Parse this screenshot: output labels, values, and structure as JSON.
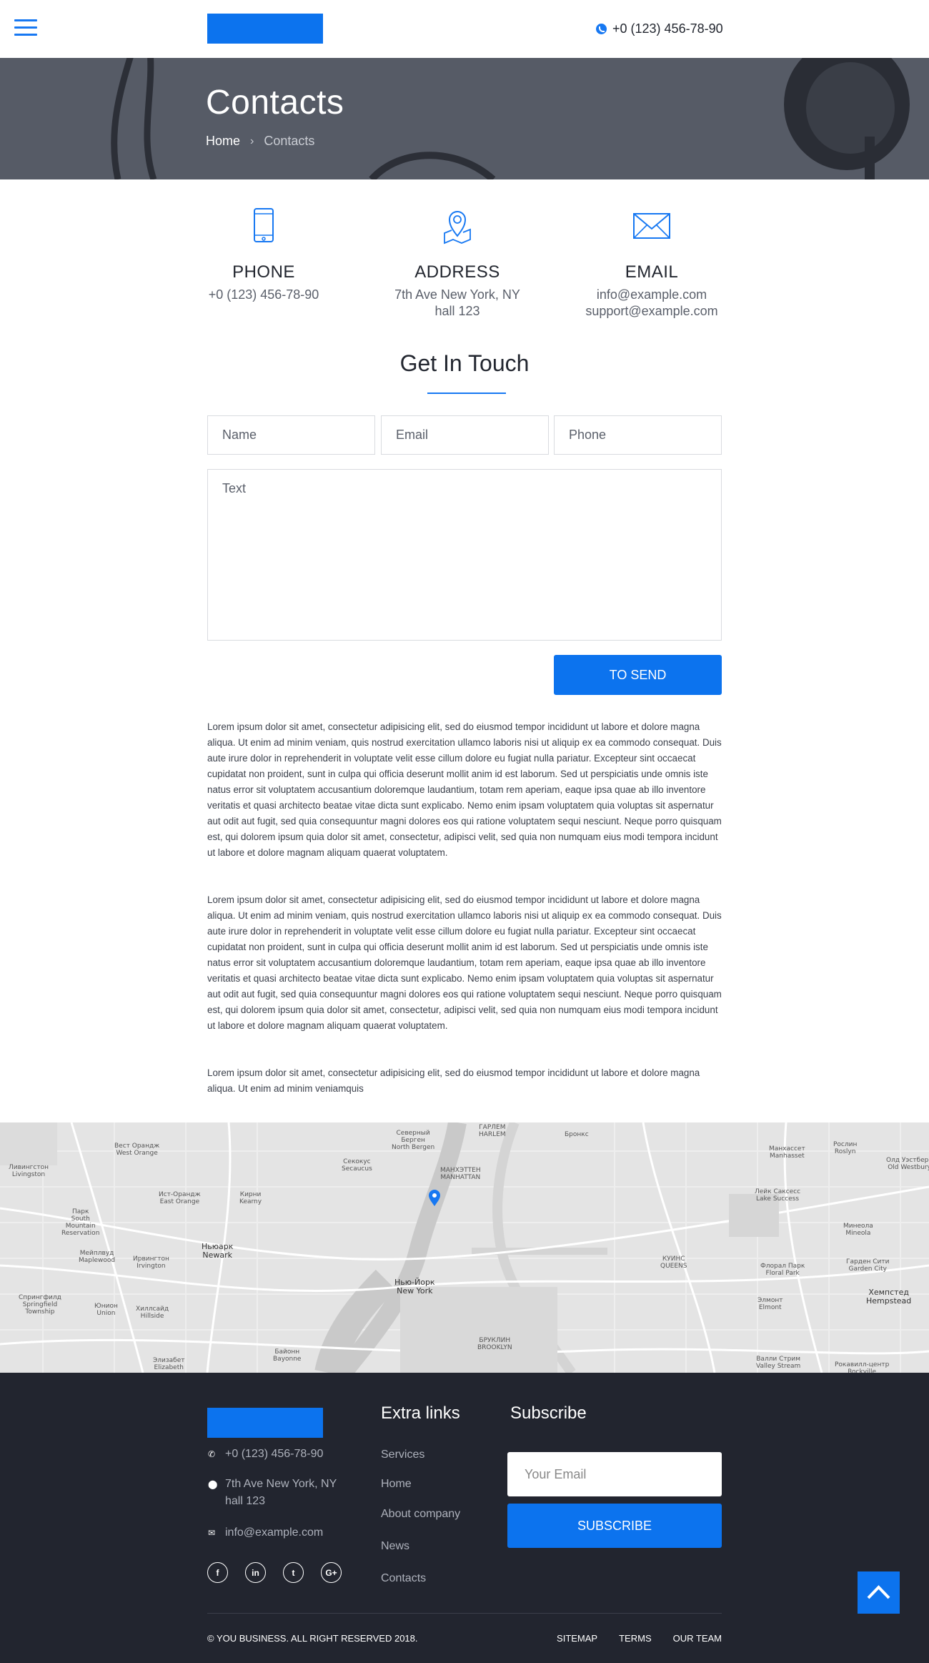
{
  "header": {
    "phone": "+0 (123) 456-78-90",
    "icons": [
      "menu-icon",
      "phone-icon"
    ]
  },
  "hero": {
    "title": "Contacts",
    "breadcrumb": {
      "home": "Home",
      "separator": "›",
      "current": "Contacts"
    }
  },
  "contact_info": [
    {
      "icon": "smartphone-icon",
      "title": "PHONE",
      "lines": [
        "+0 (123) 456-78-90"
      ]
    },
    {
      "icon": "map-pin-icon",
      "title": "ADDRESS",
      "lines": [
        "7th Ave New York, NY",
        "hall 123"
      ]
    },
    {
      "icon": "envelope-icon",
      "title": "EMAIL",
      "lines": [
        "info@example.com",
        "support@example.com"
      ]
    }
  ],
  "form": {
    "title": "Get In Touch",
    "name_placeholder": "Name",
    "email_placeholder": "Email",
    "phone_placeholder": "Phone",
    "text_placeholder": "Text",
    "submit_label": "TO SEND"
  },
  "paragraphs": [
    "Lorem ipsum dolor sit amet, consectetur adipisicing elit, sed do eiusmod tempor incididunt ut labore et dolore magna aliqua. Ut enim ad minim veniam, quis nostrud exercitation ullamco laboris nisi ut aliquip ex ea commodo consequat. Duis aute irure dolor in reprehenderit in voluptate velit esse cillum dolore eu fugiat nulla pariatur. Excepteur sint occaecat cupidatat non proident, sunt in culpa qui officia deserunt mollit anim id est laborum. Sed ut perspiciatis unde omnis iste natus error sit voluptatem accusantium doloremque laudantium, totam rem aperiam, eaque ipsa quae ab illo inventore veritatis et quasi architecto beatae vitae dicta sunt explicabo. Nemo enim ipsam voluptatem quia voluptas sit aspernatur aut odit aut fugit, sed quia consequuntur magni dolores eos qui ratione voluptatem sequi nesciunt. Neque porro quisquam est, qui dolorem ipsum quia dolor sit amet, consectetur, adipisci velit, sed quia non numquam eius modi tempora incidunt ut labore et dolore magnam aliquam quaerat voluptatem.",
    "Lorem ipsum dolor sit amet, consectetur adipisicing elit, sed do eiusmod tempor incididunt ut labore et dolore magna aliqua. Ut enim ad minim veniam, quis nostrud exercitation ullamco laboris nisi ut aliquip ex ea commodo consequat. Duis aute irure dolor in reprehenderit in voluptate velit esse cillum dolore eu fugiat nulla pariatur. Excepteur sint occaecat cupidatat non proident, sunt in culpa qui officia deserunt mollit anim id est laborum. Sed ut perspiciatis unde omnis iste natus error sit voluptatem accusantium doloremque laudantium, totam rem aperiam, eaque ipsa quae ab illo inventore veritatis et quasi architecto beatae vitae dicta sunt explicabo. Nemo enim ipsam voluptatem quia voluptas sit aspernatur aut odit aut fugit, sed quia consequuntur magni dolores eos qui ratione voluptatem sequi nesciunt. Neque porro quisquam est, qui dolorem ipsum quia dolor sit amet, consectetur, adipisci velit, sed quia non numquam eius modi tempora incidunt ut labore et dolore magnam aliquam quaerat voluptatem.",
    "Lorem ipsum dolor sit amet, consectetur adipisicing elit, sed do eiusmod tempor incididunt ut labore et dolore magna aliqua. Ut enim ad minim veniamquis"
  ],
  "map": {
    "marker_icon": "map-marker-icon",
    "labels": [
      "Вест Орандж\nWest Orange",
      "Ливингстон\nLivingston",
      "Ист-Орандж\nEast Orange",
      "Кирни\nKearny",
      "Секокус\nSecaucus",
      "Северный\nБерген\nNorth Bergen",
      "ГАРЛЕМ\nHARLEM",
      "МАНХЭТТЕН\nMANHATTAN",
      "Ньюарк\nNewark",
      "Нью-Йорк\nNew York",
      "КУИНС\nQUEENS",
      "Бронкс",
      "Манхассет\nManhasset",
      "Рослин\nRoslyn",
      "Олд Уэстбери\nOld Westbury",
      "Лейк Саксесс\nLake Success",
      "Минеола\nMineola",
      "Гарден Сити\nGarden City",
      "Хемпстед\nHempstead",
      "Флорал Парк\nFloral Park",
      "Элмонт\nElmont",
      "Валли Стрим\nValley Stream",
      "Байонн\nBayonne",
      "Элизабет\nElizabeth",
      "Юнион\nUnion",
      "Хиллсайд\nHillside",
      "Ирвингтон\nIrvington",
      "Мейплвуд\nMaplewood",
      "Спрингфилд\nSpringfield\nTownship",
      "Парк\nSouth\nMountain\nReservation",
      "БРУКЛИН\nBROOKLYN",
      "Рокавилл-центр\nRockville"
    ]
  },
  "footer": {
    "phone": "+0 (123) 456-78-90",
    "address_line1": "7th Ave New York, NY",
    "address_line2": "hall 123",
    "email": "info@example.com",
    "socials": [
      "f",
      "in",
      "t",
      "G+"
    ],
    "extra_links_title": "Extra links",
    "extra_links": [
      "Services",
      "Home",
      "About company",
      "News",
      "Contacts"
    ],
    "subscribe_title": "Subscribe",
    "subscribe_placeholder": "Your Email",
    "subscribe_button": "SUBSCRIBE",
    "copyright": "© YOU BUSINESS. ALL RIGHT RESERVED 2018.",
    "bottom_links": [
      "SITEMAP",
      "TERMS",
      "OUR TEAM"
    ]
  },
  "colors": {
    "accent": "#0c73ee",
    "hero_bg": "#565b66",
    "footer_bg": "#22252f",
    "map_bg": "#e6e6e6"
  }
}
